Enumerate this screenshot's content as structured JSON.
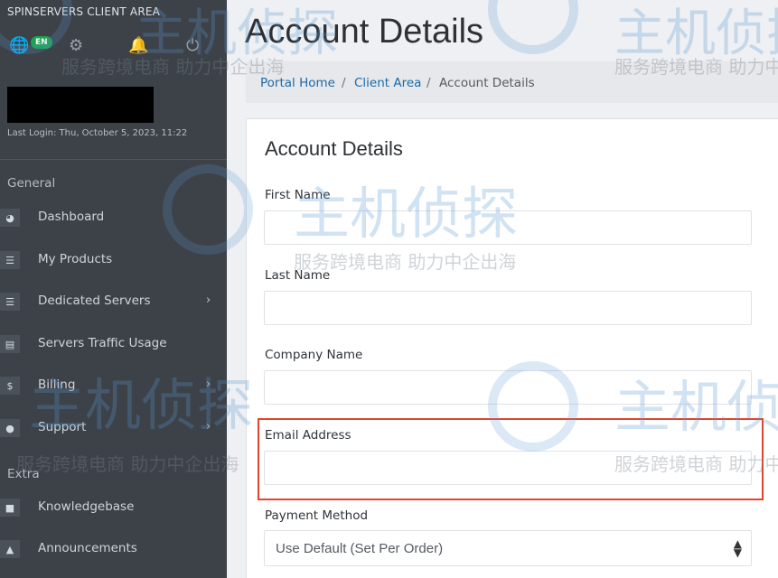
{
  "sidebar": {
    "brand": "SPINSERVERS CLIENT AREA",
    "lang_badge": "EN",
    "last_login": "Last Login: Thu, October 5, 2023, 11:22",
    "sections": {
      "general": "General",
      "extra": "Extra"
    },
    "items": [
      {
        "label": "Dashboard",
        "icon": "dashboard-icon"
      },
      {
        "label": "My Products",
        "icon": "list-icon"
      },
      {
        "label": "Dedicated Servers",
        "icon": "server-icon"
      },
      {
        "label": "Servers Traffic Usage",
        "icon": "chart-icon"
      },
      {
        "label": "Billing",
        "icon": "dollar-icon"
      },
      {
        "label": "Support",
        "icon": "chat-icon"
      },
      {
        "label": "Knowledgebase",
        "icon": "book-icon"
      },
      {
        "label": "Announcements",
        "icon": "megaphone-icon"
      }
    ]
  },
  "header": {
    "title": "Account Details"
  },
  "breadcrumb": {
    "home": "Portal Home",
    "client_area": "Client Area",
    "current": "Account Details",
    "sep": "/"
  },
  "form": {
    "title": "Account Details",
    "first_name": "First Name",
    "last_name": "Last Name",
    "company": "Company Name",
    "email": "Email Address",
    "payment_method": "Payment Method",
    "payment_selected": "Use Default (Set Per Order)"
  },
  "watermark": {
    "brand": "主机侦探",
    "slogan": "服务跨境电商 助力中企出海"
  },
  "colors": {
    "sidebar": "#3d4249",
    "link": "#1b6aa8",
    "highlight": "#e2452c",
    "badge": "#1aa34a"
  }
}
